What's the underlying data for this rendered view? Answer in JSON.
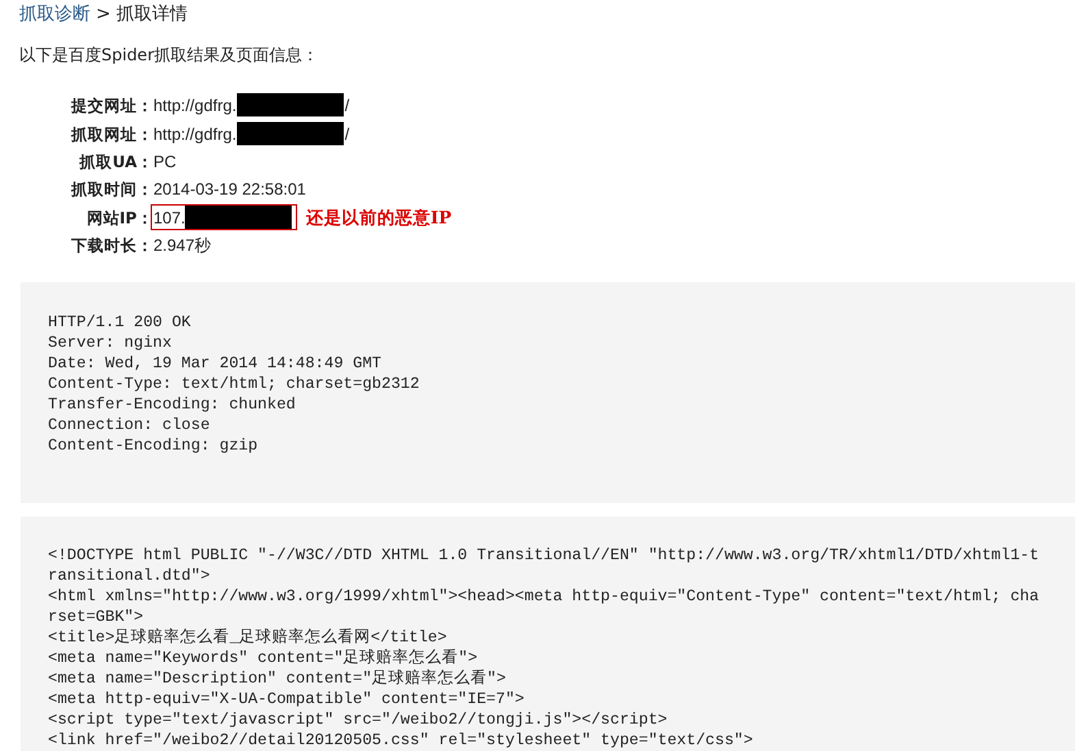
{
  "breadcrumb": {
    "parent": "抓取诊断",
    "separator": ">",
    "current": "抓取详情"
  },
  "intro": "以下是百度Spider抓取结果及页面信息：",
  "fields": [
    {
      "label": "提交网址：",
      "value_prefix": "http://gdfrg.",
      "redacted": true,
      "value_suffix": "/",
      "highlighted": false
    },
    {
      "label": "抓取网址：",
      "value_prefix": "http://gdfrg.",
      "redacted": true,
      "value_suffix": "/",
      "highlighted": false
    },
    {
      "label": "抓取UA：",
      "value_prefix": "PC",
      "redacted": false,
      "highlighted": false
    },
    {
      "label": "抓取时间：",
      "value_prefix": "2014-03-19 22:58:01",
      "redacted": false,
      "highlighted": false
    },
    {
      "label": "网站IP：",
      "value_prefix": "107.",
      "redacted": true,
      "highlighted": true,
      "annotation": "还是以前的恶意IP"
    },
    {
      "label": "下载时长：",
      "value_prefix": "2.947秒",
      "redacted": false,
      "highlighted": false
    }
  ],
  "response_headers": [
    "HTTP/1.1 200 OK",
    "Server: nginx",
    "Date: Wed, 19 Mar 2014 14:48:49 GMT",
    "Content-Type: text/html; charset=gb2312",
    "Transfer-Encoding: chunked",
    "Connection: close",
    "Content-Encoding: gzip"
  ],
  "page_source": [
    "<!DOCTYPE html PUBLIC \"-//W3C//DTD XHTML 1.0 Transitional//EN\" \"http://www.w3.org/TR/xhtml1/DTD/xhtml1-t",
    "ransitional.dtd\">",
    "<html xmlns=\"http://www.w3.org/1999/xhtml\"><head><meta http-equiv=\"Content-Type\" content=\"text/html; cha",
    "rset=GBK\">",
    "<title>足球赔率怎么看_足球赔率怎么看网</title>",
    "<meta name=\"Keywords\" content=\"足球赔率怎么看\">",
    "<meta name=\"Description\" content=\"足球赔率怎么看\">",
    "<meta http-equiv=\"X-UA-Compatible\" content=\"IE=7\">",
    "<script type=\"text/javascript\" src=\"/weibo2//tongji.js\"></script>",
    "<link href=\"/weibo2//detail20120505.css\" rel=\"stylesheet\" type=\"text/css\">"
  ]
}
